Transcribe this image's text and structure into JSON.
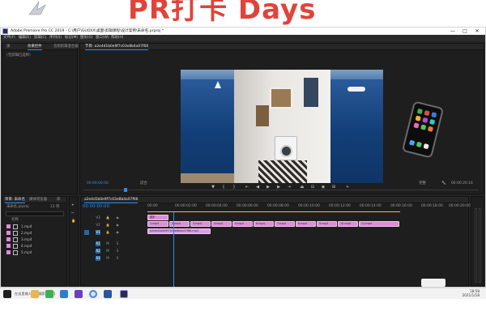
{
  "banner": {
    "title": "PR打卡 Days"
  },
  "window": {
    "title": "Adobe Premiere Pro CC 2019 - C:\\用户\\GUOXX\\桌面\\剪辑课程\\设计案例\\未命名.prproj *",
    "controls": {
      "minimize": "—",
      "maximize": "□",
      "close": "✕"
    }
  },
  "menu": [
    "文件(F)",
    "编辑(E)",
    "剪辑(C)",
    "序列(S)",
    "标记(M)",
    "图形(G)",
    "窗口(W)",
    "帮助(H)"
  ],
  "source_panel": {
    "tabs": [
      "源",
      "效果控件",
      "音频剪辑混合器"
    ],
    "message": "(无剪辑已选择)"
  },
  "program_monitor": {
    "tab": "节目: a2e4d1b0e9f7c03e8b4a07f66",
    "timecode": "00:00:00:00",
    "fit": "适合",
    "quality": "完整",
    "duration": "00:00:20:16"
  },
  "project_panel": {
    "tabs": [
      "项目: 未命名",
      "媒体浏览器",
      "库"
    ],
    "path": "未命名.prproj",
    "count": "11 项",
    "header": "名称",
    "items": [
      {
        "name": "1.mp4"
      },
      {
        "name": "2.mp4"
      },
      {
        "name": "3.mp4"
      },
      {
        "name": "4.mp4"
      },
      {
        "name": "5.mp4"
      }
    ]
  },
  "timeline": {
    "tab": "a2e4d1b0e9f7c03e8b4a07f66",
    "timecode": "00:00:00:00",
    "ruler": [
      "00:00",
      "00:00:02:00",
      "00:00:04:00",
      "00:00:06:00",
      "00:00:08:00",
      "00:00:10:00",
      "00:00:12:00",
      "00:00:14:00",
      "00:00:16:00",
      "00:00:18:00",
      "00:00:20:00"
    ],
    "tracks": [
      "V3",
      "V2",
      "V1",
      "A1",
      "A2",
      "A3"
    ],
    "title_clip": "图形",
    "audio_clip": "a2e4d1b0e9f7c03e8b4a07f66.mp3",
    "clips": [
      "1.mp4",
      "2.mp4",
      "3.mp4",
      "4.mp4",
      "5.mp4",
      "6.mp4",
      "7.mp4",
      "8.mp4",
      "9.mp4",
      "10.mp4",
      "11.mp4"
    ]
  },
  "taskbar": {
    "search": "在这里输入你要搜索的内容",
    "time": "18:58",
    "date": "2021/1/18"
  }
}
